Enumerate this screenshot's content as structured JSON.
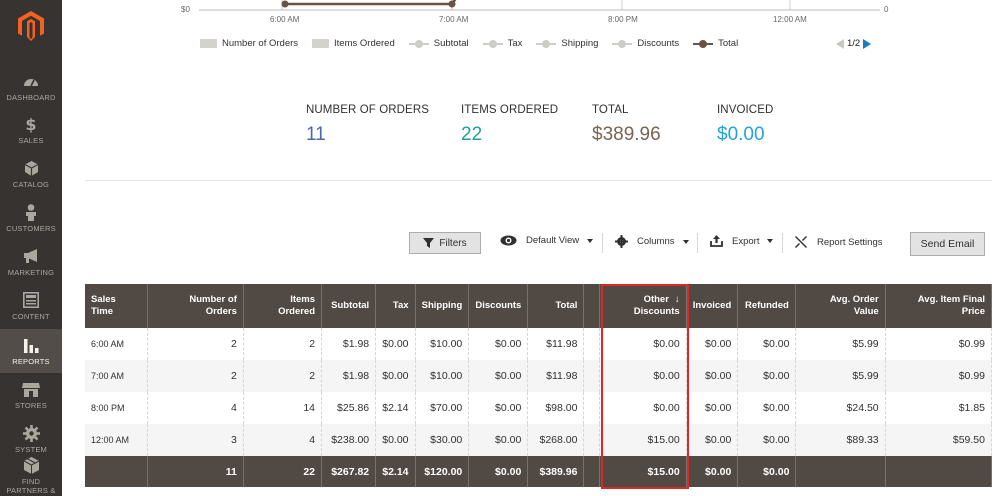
{
  "sidebar": {
    "items": [
      {
        "label": "DASHBOARD",
        "icon": "dashboard-icon"
      },
      {
        "label": "SALES",
        "icon": "dollar-icon"
      },
      {
        "label": "CATALOG",
        "icon": "box-icon"
      },
      {
        "label": "CUSTOMERS",
        "icon": "person-icon"
      },
      {
        "label": "MARKETING",
        "icon": "megaphone-icon"
      },
      {
        "label": "CONTENT",
        "icon": "content-icon"
      },
      {
        "label": "REPORTS",
        "icon": "bar-chart-icon"
      },
      {
        "label": "STORES",
        "icon": "store-icon"
      },
      {
        "label": "SYSTEM",
        "icon": "gear-icon"
      },
      {
        "label": "FIND PARTNERS & EXTENSIONS",
        "icon": "cubes-icon"
      }
    ],
    "active": "REPORTS"
  },
  "chart": {
    "y_left_label": "$0",
    "y_right_label": "0",
    "x_ticks": [
      "6:00 AM",
      "7:00 AM",
      "8:00 PM",
      "12:00 AM"
    ],
    "legend": [
      "Number of Orders",
      "Items Ordered",
      "Subtotal",
      "Tax",
      "Shipping",
      "Discounts",
      "Total"
    ],
    "page_indicator": "1/2"
  },
  "totals": [
    {
      "label": "NUMBER OF ORDERS",
      "value": "11",
      "color": "#4a67b5"
    },
    {
      "label": "ITEMS ORDERED",
      "value": "22",
      "color": "#1aa39a"
    },
    {
      "label": "TOTAL",
      "value": "$389.96",
      "color": "#7a6352"
    },
    {
      "label": "INVOICED",
      "value": "$0.00",
      "color": "#22a5d8"
    }
  ],
  "toolbar": {
    "filters": "Filters",
    "default_view": "Default View",
    "columns": "Columns",
    "export": "Export",
    "report_settings": "Report Settings",
    "send_email": "Send Email"
  },
  "table": {
    "headers": [
      "Sales\nTime",
      "Number of\nOrders",
      "Items\nOrdered",
      "Subtotal",
      "Tax",
      "Shipping",
      "Discounts",
      "Total",
      "",
      "Other\nDiscounts",
      "Invoiced",
      "Refunded",
      "Avg. Order\nValue",
      "Avg. Item Final\nPrice"
    ],
    "sort_arrow": "↓",
    "rows": [
      [
        "6:00 AM",
        "2",
        "2",
        "$1.98",
        "$0.00",
        "$10.00",
        "$0.00",
        "$11.98",
        "",
        "$0.00",
        "$0.00",
        "$0.00",
        "$5.99",
        "$0.99"
      ],
      [
        "7:00 AM",
        "2",
        "2",
        "$1.98",
        "$0.00",
        "$10.00",
        "$0.00",
        "$11.98",
        "",
        "$0.00",
        "$0.00",
        "$0.00",
        "$5.99",
        "$0.99"
      ],
      [
        "8:00 PM",
        "4",
        "14",
        "$25.86",
        "$2.14",
        "$70.00",
        "$0.00",
        "$98.00",
        "",
        "$0.00",
        "$0.00",
        "$0.00",
        "$24.50",
        "$1.85"
      ],
      [
        "12:00 AM",
        "3",
        "4",
        "$238.00",
        "$0.00",
        "$30.00",
        "$0.00",
        "$268.00",
        "",
        "$15.00",
        "$0.00",
        "$0.00",
        "$89.33",
        "$59.50"
      ]
    ],
    "footer": [
      "",
      "11",
      "22",
      "$267.82",
      "$2.14",
      "$120.00",
      "$0.00",
      "$389.96",
      "",
      "$15.00",
      "$0.00",
      "$0.00",
      "",
      ""
    ]
  },
  "colors": {
    "sidebar_bg": "#373330",
    "header_bg": "#514943",
    "highlight": "#e22626",
    "brand": "#eb5202"
  }
}
